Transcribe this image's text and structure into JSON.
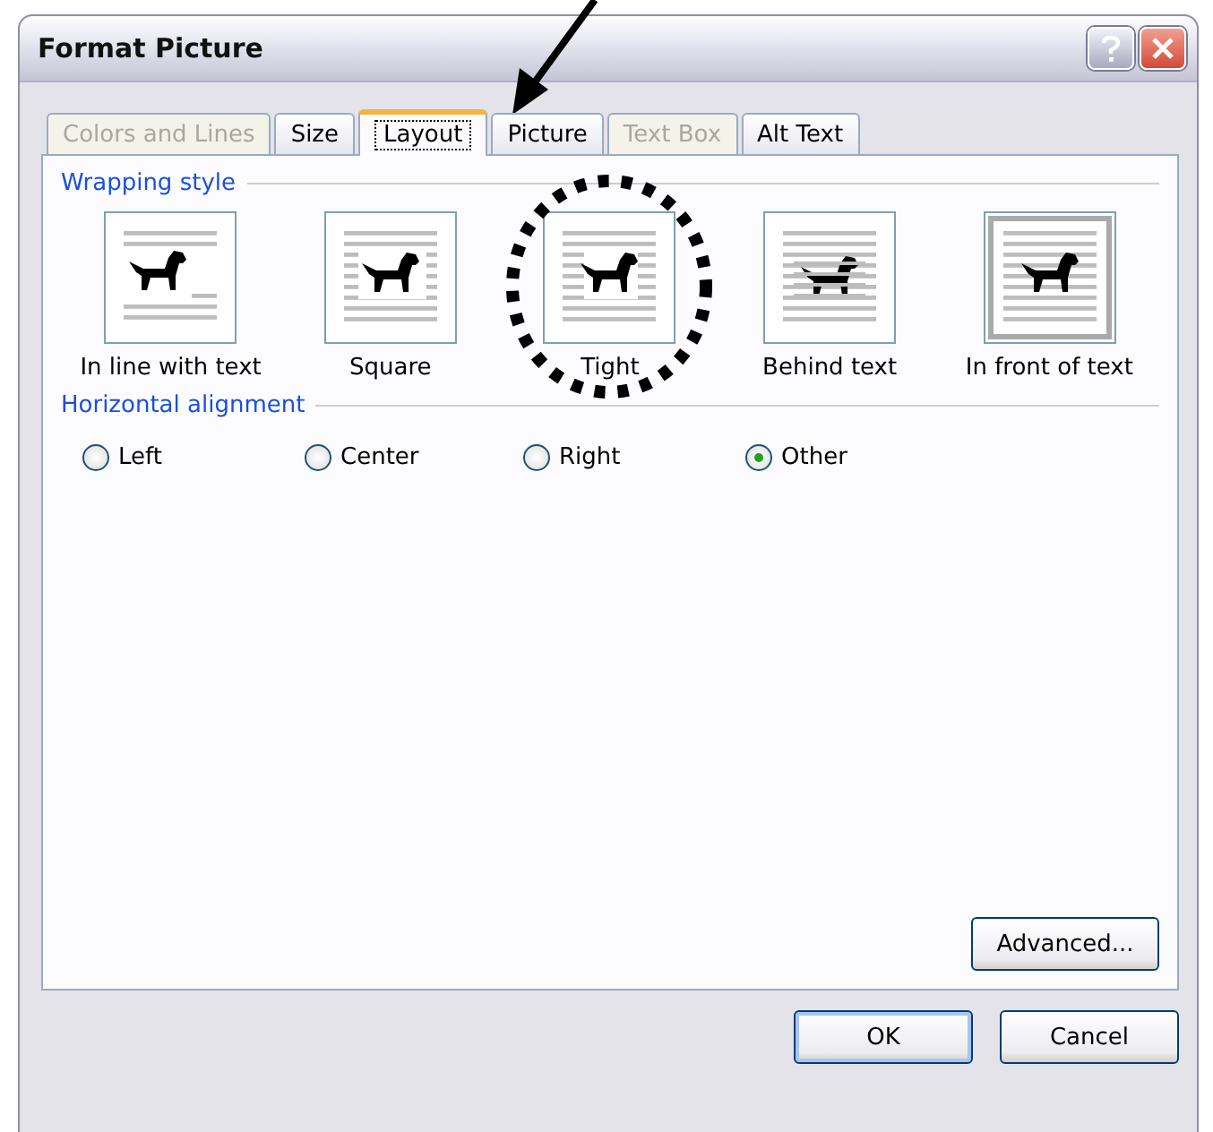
{
  "window": {
    "title": "Format Picture"
  },
  "tabs": [
    {
      "label": "Colors and Lines",
      "selected": false,
      "disabled": true
    },
    {
      "label": "Size",
      "selected": false,
      "disabled": false
    },
    {
      "label": "Layout",
      "selected": true,
      "disabled": false
    },
    {
      "label": "Picture",
      "selected": false,
      "disabled": false
    },
    {
      "label": "Text Box",
      "selected": false,
      "disabled": true
    },
    {
      "label": "Alt Text",
      "selected": false,
      "disabled": false
    }
  ],
  "wrapping_style": {
    "heading": "Wrapping style",
    "options": [
      {
        "label": "In line with text",
        "kind": "inline",
        "circled": false
      },
      {
        "label": "Square",
        "kind": "square",
        "circled": false
      },
      {
        "label": "Tight",
        "kind": "tight",
        "circled": true
      },
      {
        "label": "Behind text",
        "kind": "behind",
        "circled": false
      },
      {
        "label": "In front of text",
        "kind": "front",
        "circled": false
      }
    ]
  },
  "horizontal_alignment": {
    "heading": "Horizontal alignment",
    "options": [
      {
        "label": "Left",
        "selected": false
      },
      {
        "label": "Center",
        "selected": false
      },
      {
        "label": "Right",
        "selected": false
      },
      {
        "label": "Other",
        "selected": true
      }
    ]
  },
  "advanced_button": "Advanced...",
  "buttons": [
    "OK",
    "Cancel"
  ]
}
